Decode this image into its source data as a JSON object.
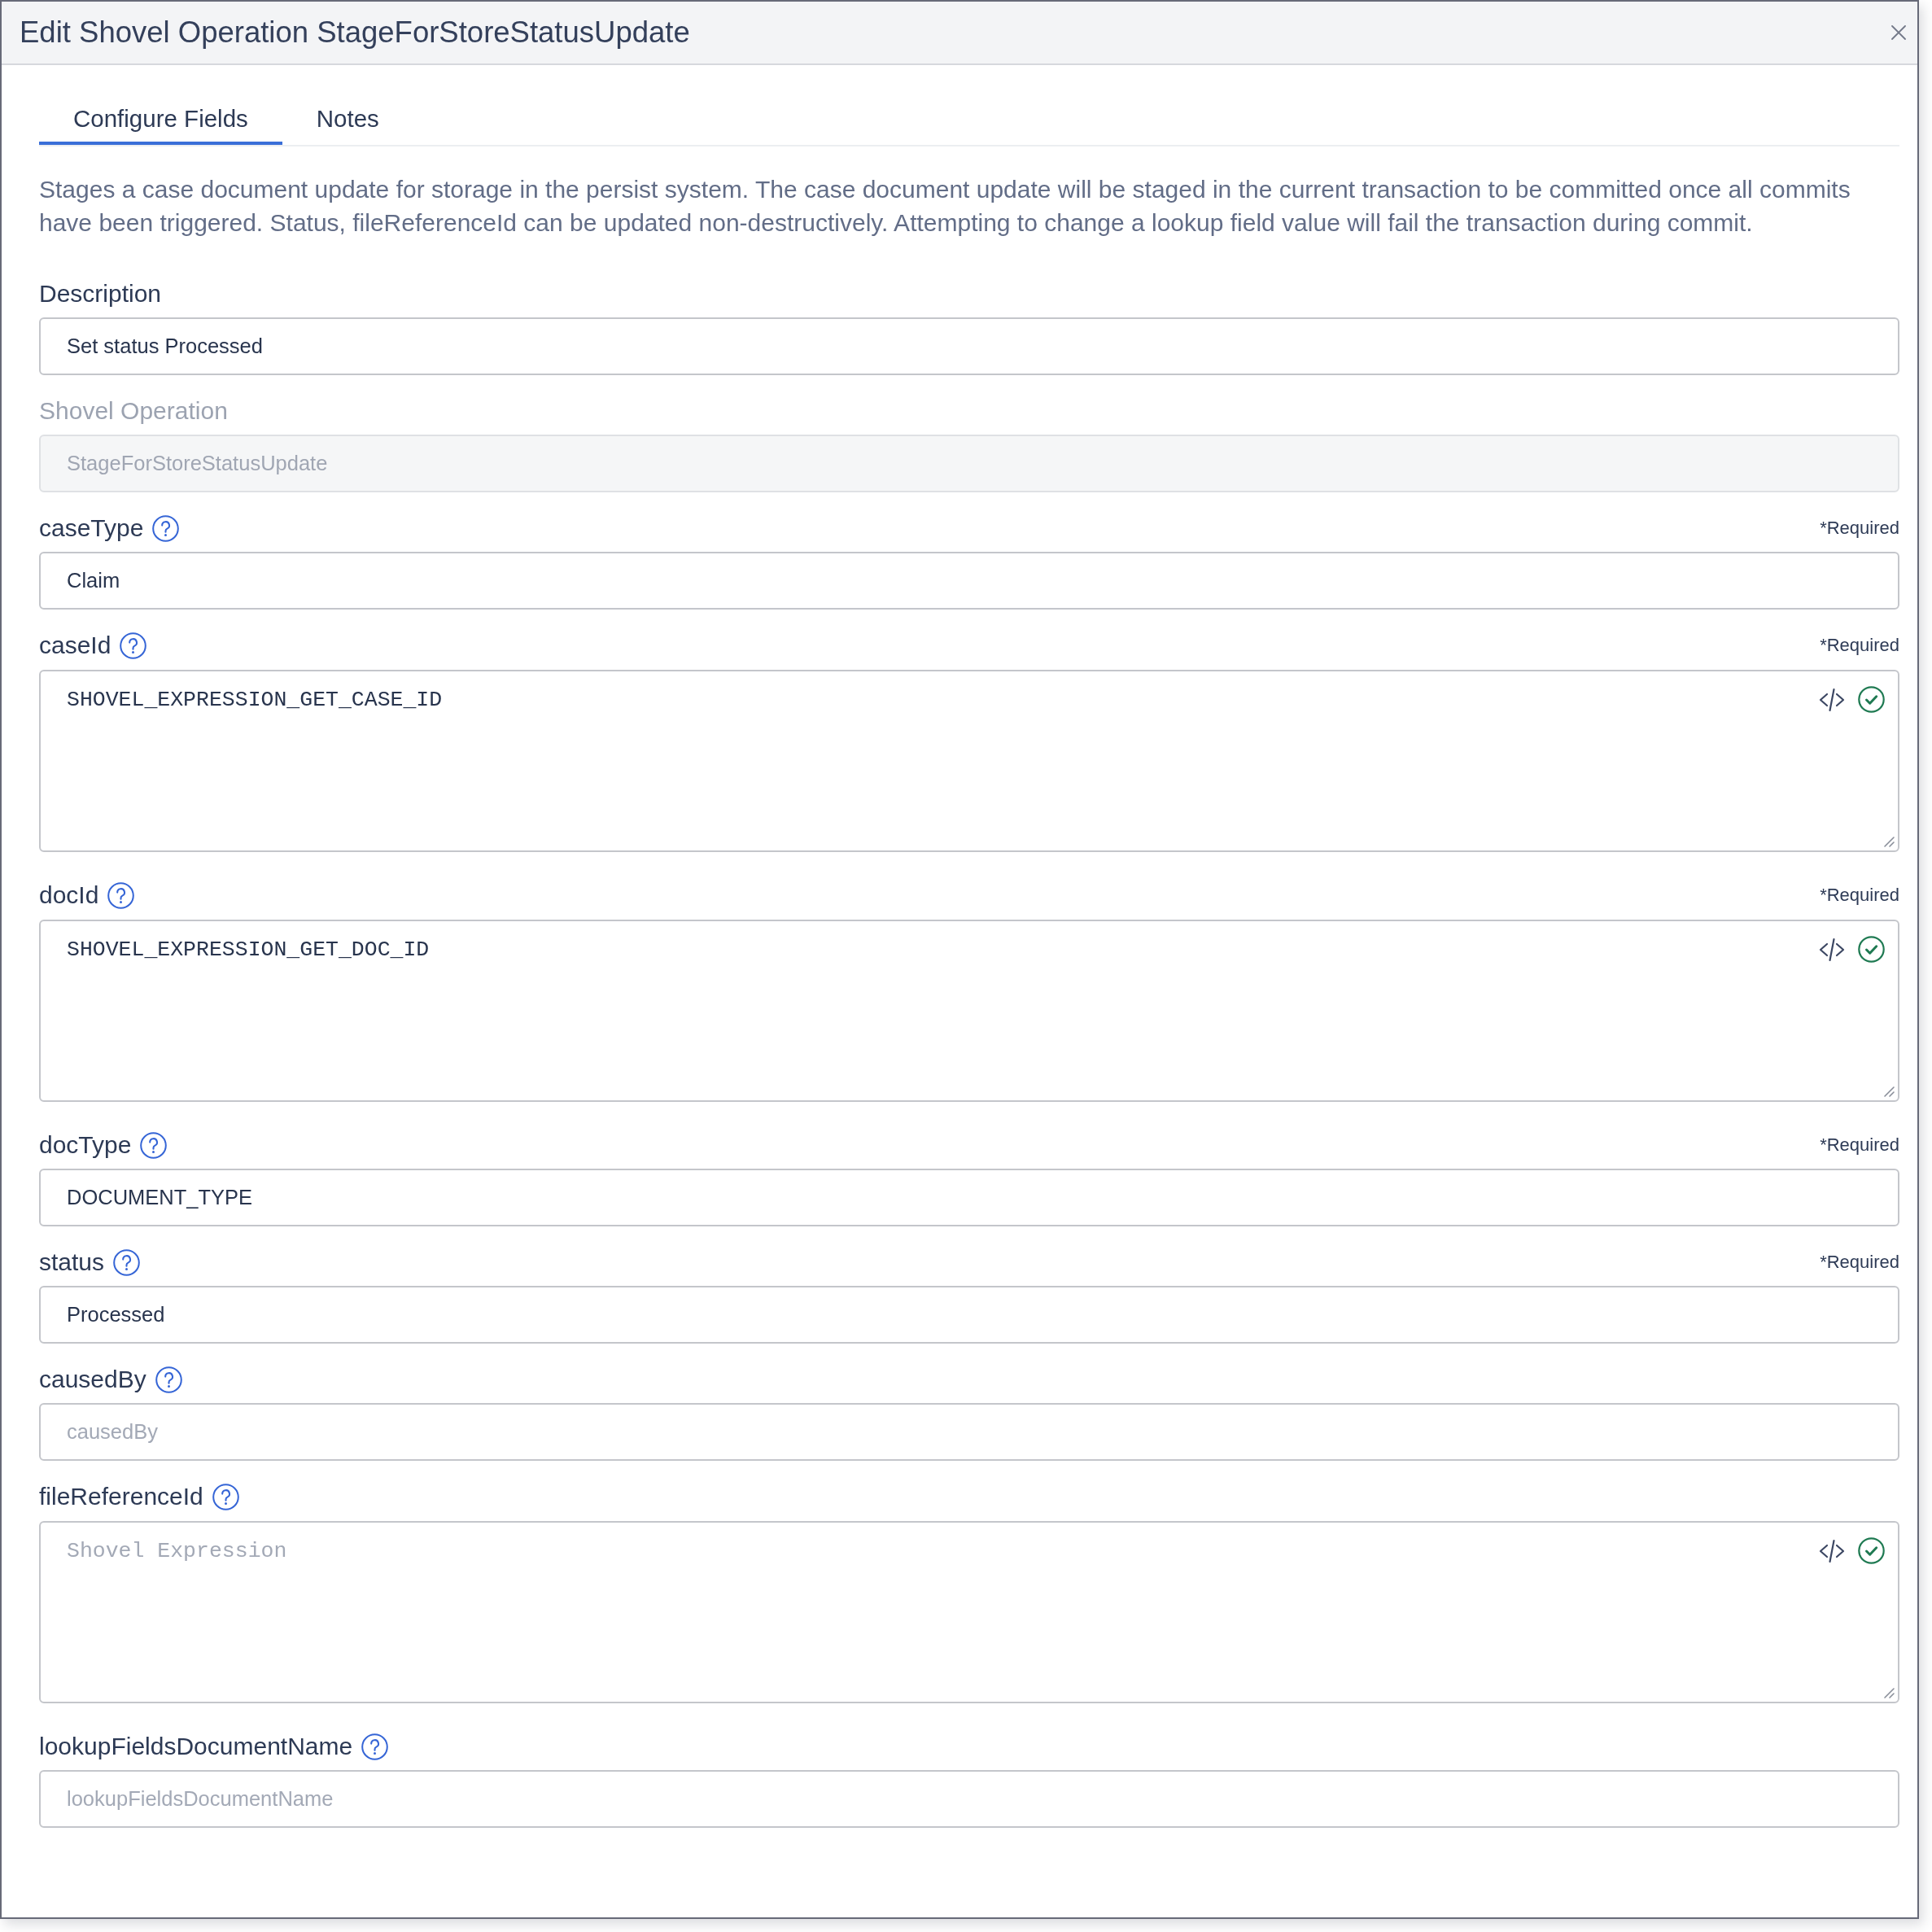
{
  "dialog": {
    "title": "Edit Shovel Operation StageForStoreStatusUpdate"
  },
  "tabs": [
    {
      "label": "Configure Fields",
      "selected": true
    },
    {
      "label": "Notes",
      "selected": false
    }
  ],
  "intro": "Stages a case document update for storage in the persist system. The case document update will be staged in the current transaction to be committed once all commits have been triggered. Status, fileReferenceId can be updated non-destructively. Attempting to change a lookup field value will fail the transaction during commit.",
  "fields": [
    {
      "kind": "input",
      "label": "Description",
      "value": "Set status Processed",
      "help": false,
      "disabled": false
    },
    {
      "kind": "input",
      "label": "Shovel Operation",
      "value": "StageForStoreStatusUpdate",
      "help": false,
      "disabled": true
    },
    {
      "kind": "input",
      "label": "caseType",
      "value": "Claim",
      "help": true,
      "required_note": "*Required",
      "disabled": false
    },
    {
      "kind": "expression",
      "label": "caseId",
      "value": "SHOVEL_EXPRESSION_GET_CASE_ID",
      "help": true,
      "required_note": "*Required",
      "disabled": false,
      "valid": true
    },
    {
      "kind": "expression",
      "label": "docId",
      "value": "SHOVEL_EXPRESSION_GET_DOC_ID",
      "help": true,
      "required_note": "*Required",
      "disabled": false,
      "valid": true
    },
    {
      "kind": "input",
      "label": "docType",
      "value": "DOCUMENT_TYPE",
      "help": true,
      "required_note": "*Required",
      "disabled": false
    },
    {
      "kind": "input",
      "label": "status",
      "value": "Processed",
      "help": true,
      "required_note": "*Required",
      "disabled": false
    },
    {
      "kind": "input",
      "label": "causedBy",
      "placeholder": "causedBy",
      "help": true,
      "disabled": false
    },
    {
      "kind": "expression",
      "label": "fileReferenceId",
      "placeholder": "Shovel Expression",
      "help": true,
      "disabled": false,
      "valid": true
    },
    {
      "kind": "input",
      "label": "lookupFieldsDocumentName",
      "placeholder": "lookupFieldsDocumentName",
      "help": true,
      "disabled": false
    }
  ]
}
